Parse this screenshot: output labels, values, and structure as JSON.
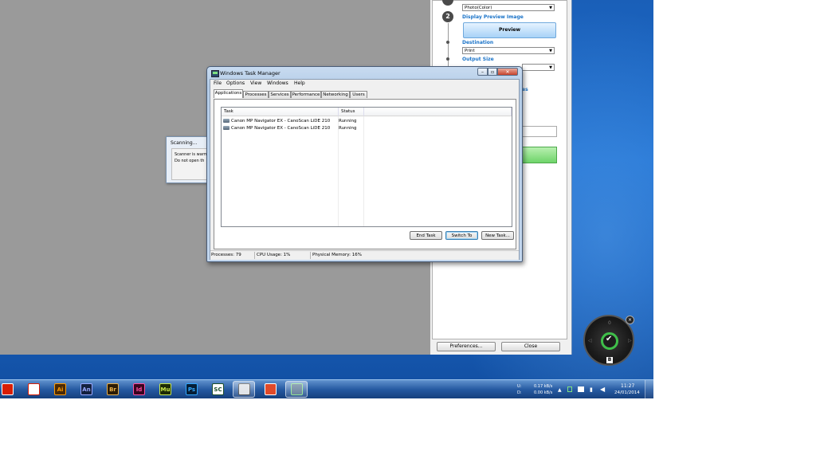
{
  "mp_navigator": {
    "step2_number": "2",
    "color_mode_value": "Photo(Color)",
    "display_preview_label": "Display Preview Image",
    "preview_button": "Preview",
    "destination_label": "Destination",
    "destination_value": "Print",
    "output_size_label": "Output Size",
    "partial_label_es": "es",
    "preferences_button": "Preferences...",
    "close_button": "Close"
  },
  "scanning_dialog": {
    "title": "Scanning...",
    "line1": "Scanner is warm",
    "line2": "Do not open th"
  },
  "task_manager": {
    "title": "Windows Task Manager",
    "menu": [
      "File",
      "Options",
      "View",
      "Windows",
      "Help"
    ],
    "tabs": [
      "Applications",
      "Processes",
      "Services",
      "Performance",
      "Networking",
      "Users"
    ],
    "active_tab": "Applications",
    "columns": [
      "Task",
      "Status"
    ],
    "rows": [
      {
        "task": "Canon MP Navigator EX - CanoScan LiDE 210",
        "status": "Running"
      },
      {
        "task": "Canon MP Navigator EX - CanoScan LiDE 210",
        "status": "Running"
      }
    ],
    "buttons": {
      "end_task": "End Task",
      "switch_to": "Switch To",
      "new_task": "New Task..."
    },
    "status_bar": {
      "processes": "Processes: 79",
      "cpu": "CPU Usage: 1%",
      "memory": "Physical Memory: 16%"
    }
  },
  "gadget": {
    "top": "0",
    "badge": "B",
    "close": "×"
  },
  "taskbar": {
    "icons": [
      {
        "name": "creative-cloud-icon",
        "label": "",
        "bg": "#d81e05",
        "fg": "#ffffff"
      },
      {
        "name": "acrobat-icon",
        "label": "",
        "bg": "#ffffff",
        "fg": "#d81e05"
      },
      {
        "name": "illustrator-icon",
        "label": "Ai",
        "bg": "#4a2a05",
        "fg": "#ff9a00"
      },
      {
        "name": "animate-icon",
        "label": "An",
        "bg": "#14213f",
        "fg": "#9aa7ff"
      },
      {
        "name": "bridge-icon",
        "label": "Br",
        "bg": "#2b1b05",
        "fg": "#e9b04a"
      },
      {
        "name": "indesign-icon",
        "label": "Id",
        "bg": "#3a0420",
        "fg": "#ff4fa0"
      },
      {
        "name": "muse-icon",
        "label": "Mu",
        "bg": "#1c2a05",
        "fg": "#c9e84a"
      },
      {
        "name": "photoshop-icon",
        "label": "Ps",
        "bg": "#061e36",
        "fg": "#31a8ff"
      },
      {
        "name": "sc-app-icon",
        "label": "SC",
        "bg": "#ffffff",
        "fg": "#1d4f2a"
      },
      {
        "name": "scanner-app-icon",
        "label": "",
        "bg": "#d9dde2",
        "fg": "#333333"
      },
      {
        "name": "tool-app-icon",
        "label": "",
        "bg": "#e04a2a",
        "fg": "#ffffff"
      },
      {
        "name": "task-manager-app-icon",
        "label": "",
        "bg": "#4b6b8b",
        "fg": "#7fe07f"
      }
    ],
    "net_up_label": "U:",
    "net_down_label": "D:",
    "net_up_value": "0.17 kB/s",
    "net_down_value": "0.00 kB/s",
    "time": "11:27",
    "date": "24/01/2014"
  }
}
